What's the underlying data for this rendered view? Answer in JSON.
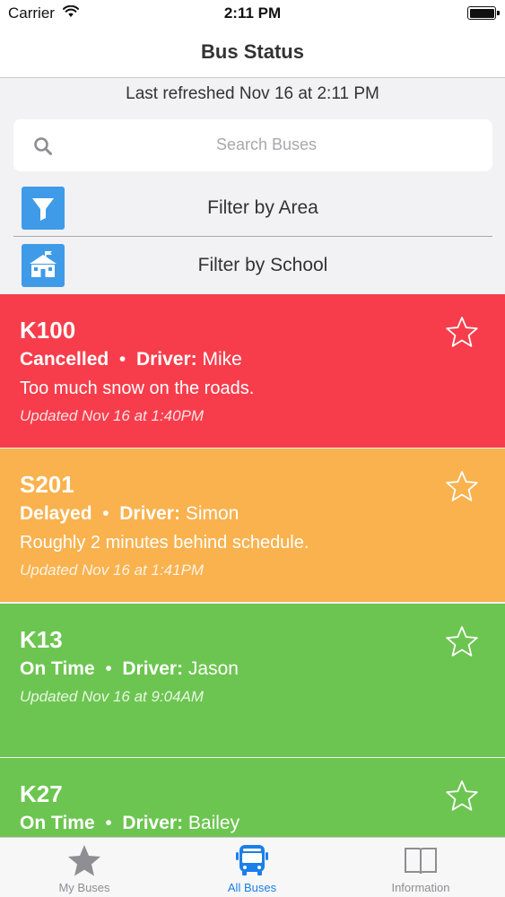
{
  "status_bar": {
    "carrier": "Carrier",
    "time": "2:11 PM"
  },
  "nav": {
    "title": "Bus Status"
  },
  "refresh": {
    "text": "Last refreshed Nov 16 at 2:11 PM"
  },
  "search": {
    "placeholder": "Search Buses"
  },
  "filters": {
    "area_label": "Filter by Area",
    "school_label": "Filter by School"
  },
  "buses": [
    {
      "name": "K100",
      "status": "Cancelled",
      "driver_label": "Driver:",
      "driver": "Mike",
      "note": "Too much snow on the roads.",
      "updated": "Updated Nov 16 at 1:40PM",
      "color": "#f73d4b",
      "favorited": false
    },
    {
      "name": "S201",
      "status": "Delayed",
      "driver_label": "Driver:",
      "driver": "Simon",
      "note": "Roughly 2 minutes behind schedule.",
      "updated": "Updated Nov 16 at 1:41PM",
      "color": "#f9b24e",
      "favorited": false
    },
    {
      "name": "K13",
      "status": "On Time",
      "driver_label": "Driver:",
      "driver": "Jason",
      "note": "",
      "updated": "Updated Nov 16 at 9:04AM",
      "color": "#6cc550",
      "favorited": false
    },
    {
      "name": "K27",
      "status": "On Time",
      "driver_label": "Driver:",
      "driver": "Bailey",
      "note": "",
      "updated": "",
      "color": "#6cc550",
      "favorited": false
    }
  ],
  "tab_bar": {
    "tabs": [
      {
        "label": "My Buses",
        "icon": "star-icon",
        "selected": false
      },
      {
        "label": "All Buses",
        "icon": "bus-icon",
        "selected": true
      },
      {
        "label": "Information",
        "icon": "book-icon",
        "selected": false
      }
    ]
  },
  "colors": {
    "accent": "#1a7fe8",
    "filter_icon_bg": "#3f9be8",
    "cancelled": "#f73d4b",
    "delayed": "#f9b24e",
    "on_time": "#6cc550"
  }
}
